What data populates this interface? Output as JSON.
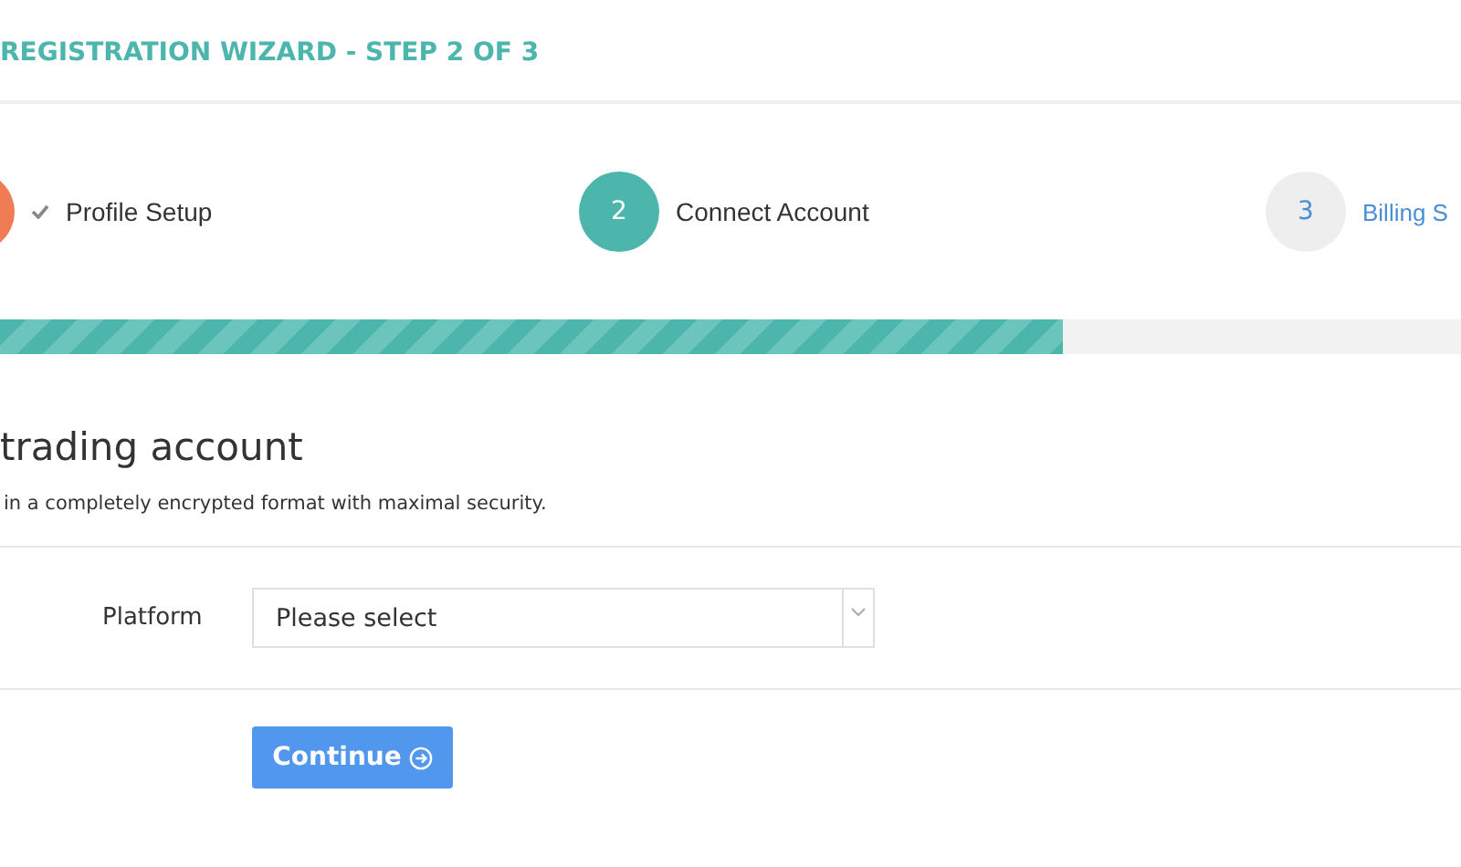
{
  "header": {
    "title": "REGISTRATION WIZARD - STEP 2 OF 3"
  },
  "steps": [
    {
      "completed": true,
      "selected": false,
      "label": "Profile Setup"
    },
    {
      "completed": false,
      "selected": true,
      "number": "2",
      "label": "Connect Account"
    },
    {
      "completed": false,
      "selected": false,
      "number": "3",
      "label": "Billing S"
    }
  ],
  "progress": {
    "level": 0.7275
  },
  "section": {
    "heading": "trading account",
    "description": "in a completely encrypted format with maximal security."
  },
  "form": {
    "fields": [
      {
        "label": "Platform",
        "value": "Please select"
      }
    ]
  },
  "buttons": [
    {
      "label": "Continue"
    }
  ]
}
